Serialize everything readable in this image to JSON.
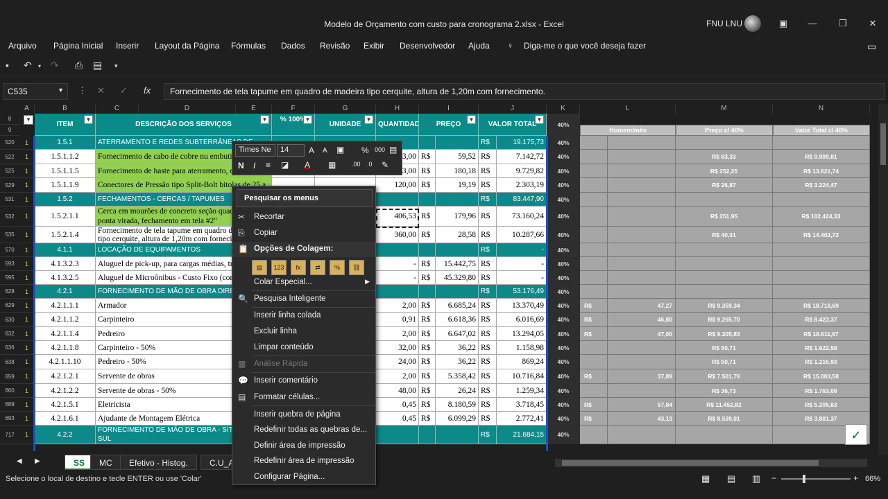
{
  "window": {
    "title": "Modelo de Orçamento com custo para cronograma 2.xlsx  -  Excel",
    "user": "FNU LNU"
  },
  "menu": [
    "Arquivo",
    "Página Inicial",
    "Inserir",
    "Layout da Página",
    "Fórmulas",
    "Dados",
    "Revisão",
    "Exibir",
    "Desenvolvedor",
    "Ajuda"
  ],
  "tell_me": "Diga-me o que você deseja fazer",
  "namebox": "C535",
  "formula": "Fornecimento de tela tapume em quadro de madeira tipo cerquite, altura de 1,20m com fornecimento.",
  "columns": [
    "A",
    "B",
    "C",
    "D",
    "E",
    "F",
    "G",
    "H",
    "I",
    "J",
    "K",
    "L",
    "M",
    "N"
  ],
  "headers": {
    "item": "ITEM",
    "desc": "DESCRIÇÃO DOS SERVIÇOS",
    "pct": "% 100%",
    "unidade": "UNIDADE",
    "quantidade": "QUANTIDADE",
    "preco": "PREÇO",
    "valor_total": "VALOR TOTAL",
    "k": "40%",
    "l": "Homem/mês",
    "m": "Preço c/ 40%",
    "n": "Valor Total c/ 40%"
  },
  "rows": [
    {
      "rn": "520",
      "a": "1",
      "item": "1.5.1",
      "desc": "ATERRAMENTO E REDES SUBTERRÂNEAS DE",
      "qty": "",
      "rs1": "",
      "preco": "",
      "rs2": "R$",
      "total": "19.175,73",
      "type": "teal",
      "l1": "",
      "l2": "",
      "m": "",
      "n": ""
    },
    {
      "rn": "522",
      "a": "1",
      "item": "1.5.1.1.2",
      "desc": "Fornecimento de cabo de cobre nu embutido escavação em terra até 50 cm de profundidade",
      "qty": "3,00",
      "rs1": "R$",
      "preco": "59,52",
      "rs2": "R$",
      "total": "7.142,72",
      "type": "green",
      "l1": "",
      "l2": "",
      "m": "R$ 83,33",
      "n": "R$ 9.999,81"
    },
    {
      "rn": "525",
      "a": "1",
      "item": "1.5.1.1.5",
      "desc": "Fornecimento de haste para aterramento, em",
      "qty": "3,00",
      "rs1": "R$",
      "preco": "180,18",
      "rs2": "R$",
      "total": "9.729,82",
      "type": "green",
      "l1": "",
      "l2": "",
      "m": "R$ 252,25",
      "n": "R$ 13.621,74"
    },
    {
      "rn": "529",
      "a": "1",
      "item": "1.5.1.1.9",
      "desc": "Conectores de Pressão tipo Split-Bolt bitolas de 25 a 70mm2",
      "qty": "120,00",
      "rs1": "R$",
      "preco": "19,19",
      "rs2": "R$",
      "total": "2.303,19",
      "type": "green",
      "l1": "",
      "l2": "",
      "m": "R$ 26,87",
      "n": "R$ 3.224,47"
    },
    {
      "rn": "531",
      "a": "1",
      "item": "1.5.2",
      "desc": "FECHAMENTOS - CERCAS / TAPUMES",
      "qty": "",
      "rs1": "",
      "preco": "",
      "rs2": "R$",
      "total": "83.447,90",
      "type": "teal",
      "l1": "",
      "l2": "",
      "m": "",
      "n": ""
    },
    {
      "rn": "532",
      "a": "1",
      "item": "1.5.2.1.1",
      "desc": "Cerca em mourões de concreto seção quadrada 2,5m, ponta virada, fechamento em tela #2\"",
      "qty": "406,53",
      "rs1": "R$",
      "preco": "179,96",
      "rs2": "R$",
      "total": "73.160,24",
      "type": "green",
      "l1": "",
      "l2": "",
      "m": "R$ 251,95",
      "n": "R$ 102.424,33"
    },
    {
      "rn": "535",
      "a": "1",
      "item": "1.5.2.1.4",
      "desc": "Fornecimento de tela tapume em quadro de madeira tipo cerquite, altura de 1,20m com fornecimento",
      "qty": "360,00",
      "rs1": "R$",
      "preco": "28,58",
      "rs2": "R$",
      "total": "10.287,66",
      "type": "white",
      "l1": "",
      "l2": "",
      "m": "R$ 40,01",
      "n": "R$ 14.402,72"
    },
    {
      "rn": "570",
      "a": "1",
      "item": "4.1.1",
      "desc": "LOCAÇÃO DE EQUIPAMENTOS",
      "qty": "",
      "rs1": "",
      "preco": "",
      "rs2": "R$",
      "total": "-",
      "type": "teal",
      "l1": "",
      "l2": "",
      "m": "",
      "n": ""
    },
    {
      "rn": "593",
      "a": "1",
      "item": "4.1.3.2.3",
      "desc": "Aluguel de pick-up, para cargas médias, tração 4x4 - 5 lugares (Tipo Hilux, Amarok, etc.)",
      "qty": "-",
      "rs1": "R$",
      "preco": "15.442,75",
      "rs2": "R$",
      "total": "-",
      "type": "white",
      "l1": "",
      "l2": "",
      "m": "",
      "n": ""
    },
    {
      "rn": "595",
      "a": "1",
      "item": "4.1.3.2.5",
      "desc": "Aluguel de Microônibus - Custo Fixo (com motorista) inclusive combustível",
      "qty": "-",
      "rs1": "R$",
      "preco": "45.329,80",
      "rs2": "R$",
      "total": "-",
      "type": "white",
      "l1": "",
      "l2": "",
      "m": "",
      "n": ""
    },
    {
      "rn": "628",
      "a": "1",
      "item": "4.2.1",
      "desc": "FORNECIMENTO DE MÃO DE OBRA DIRETA -",
      "qty": "",
      "rs1": "",
      "preco": "",
      "rs2": "R$",
      "total": "53.176,49",
      "type": "teal",
      "l1": "",
      "l2": "",
      "m": "",
      "n": ""
    },
    {
      "rn": "629",
      "a": "1",
      "item": "4.2.1.1.1",
      "desc": "Armador",
      "qty": "2,00",
      "rs1": "R$",
      "preco": "6.685,24",
      "rs2": "R$",
      "total": "13.370,49",
      "type": "white",
      "l1": "R$",
      "l2": "47,27",
      "m": "R$ 9.359,34",
      "n": "R$ 18.718,69"
    },
    {
      "rn": "630",
      "a": "1",
      "item": "4.2.1.1.2",
      "desc": "Carpinteiro",
      "qty": "0,91",
      "rs1": "R$",
      "preco": "6.618,36",
      "rs2": "R$",
      "total": "6.016,69",
      "type": "white",
      "l1": "R$",
      "l2": "46,80",
      "m": "R$ 9.265,70",
      "n": "R$ 8.423,37"
    },
    {
      "rn": "632",
      "a": "1",
      "item": "4.2.1.1.4",
      "desc": "Pedreiro",
      "qty": "2,00",
      "rs1": "R$",
      "preco": "6.647,02",
      "rs2": "R$",
      "total": "13.294,05",
      "type": "white",
      "l1": "R$",
      "l2": "47,00",
      "m": "R$ 9.305,83",
      "n": "R$ 18.611,67"
    },
    {
      "rn": "636",
      "a": "1",
      "item": "4.2.1.1.8",
      "desc": "Carpinteiro - 50%",
      "qty": "32,00",
      "rs1": "R$",
      "preco": "36,22",
      "rs2": "R$",
      "total": "1.158,98",
      "type": "white",
      "l1": "",
      "l2": "",
      "m": "R$ 50,71",
      "n": "R$ 1.622,58"
    },
    {
      "rn": "638",
      "a": "1",
      "item": "4.2.1.1.10",
      "desc": "Pedreiro - 50%",
      "qty": "24,00",
      "rs1": "R$",
      "preco": "36,22",
      "rs2": "R$",
      "total": "869,24",
      "type": "white",
      "l1": "",
      "l2": "",
      "m": "R$ 50,71",
      "n": "R$ 1.216,93"
    },
    {
      "rn": "659",
      "a": "1",
      "item": "4.2.1.2.1",
      "desc": "Servente de obras",
      "qty": "2,00",
      "rs1": "R$",
      "preco": "5.358,42",
      "rs2": "R$",
      "total": "10.716,84",
      "type": "white",
      "l1": "R$",
      "l2": "37,89",
      "m": "R$ 7.501,79",
      "n": "R$ 15.003,58"
    },
    {
      "rn": "660",
      "a": "1",
      "item": "4.2.1.2.2",
      "desc": "Servente de obras - 50%",
      "qty": "48,00",
      "rs1": "R$",
      "preco": "26,24",
      "rs2": "R$",
      "total": "1.259,34",
      "type": "white",
      "l1": "",
      "l2": "",
      "m": "R$ 36,73",
      "n": "R$ 1.763,08"
    },
    {
      "rn": "689",
      "a": "1",
      "item": "4.2.1.5.1",
      "desc": "Eletricista",
      "qty": "0,45",
      "rs1": "R$",
      "preco": "8.180,59",
      "rs2": "R$",
      "total": "3.718,45",
      "type": "white",
      "l1": "R$",
      "l2": "57,84",
      "m": "R$ 11.452,82",
      "n": "R$ 5.205,83"
    },
    {
      "rn": "693",
      "a": "1",
      "item": "4.2.1.6.1",
      "desc": "Ajudante de Montagem Elétrica",
      "qty": "0,45",
      "rs1": "R$",
      "preco": "6.099,29",
      "rs2": "R$",
      "total": "2.772,41",
      "type": "white",
      "l1": "R$",
      "l2": "43,13",
      "m": "R$ 8.539,01",
      "n": "R$ 3.881,37"
    },
    {
      "rn": "717",
      "a": "1",
      "item": "4.2.2",
      "desc": "FORNECIMENTO DE MÃO DE OBRA - SITE SERRA SUL",
      "qty": "",
      "rs1": "",
      "preco": "",
      "rs2": "R$",
      "total": "21.684,15",
      "type": "teal",
      "l1": "",
      "l2": "",
      "m": "",
      "n": ""
    }
  ],
  "k_value": "40%",
  "mini_toolbar": {
    "font": "Times Ne",
    "size": "14"
  },
  "context_menu": {
    "search": "Pesquisar os menus",
    "items": [
      {
        "label": "Recortar",
        "icon": "✂"
      },
      {
        "label": "Copiar",
        "icon": "⎘"
      },
      {
        "label": "Opções de Colagem:",
        "icon": "📋"
      },
      {
        "label": "Colar Especial...",
        "icon": ""
      },
      {
        "label": "Pesquisa Inteligente",
        "icon": "🔍"
      },
      {
        "label": "Inserir linha colada",
        "icon": ""
      },
      {
        "label": "Excluir linha",
        "icon": ""
      },
      {
        "label": "Limpar conteúdo",
        "icon": ""
      },
      {
        "label": "Análise Rápida",
        "icon": "▦"
      },
      {
        "label": "Inserir comentário",
        "icon": "💬"
      },
      {
        "label": "Formatar células...",
        "icon": "▤"
      },
      {
        "label": "Inserir quebra de página",
        "icon": ""
      },
      {
        "label": "Redefinir todas as quebras de...",
        "icon": ""
      },
      {
        "label": "Definir área de impressão",
        "icon": ""
      },
      {
        "label": "Redefinir área de impressão",
        "icon": ""
      },
      {
        "label": "Configurar Página...",
        "icon": ""
      }
    ]
  },
  "sheets": [
    "SS",
    "MC",
    "Efetivo - Histog.",
    "C.U_Ac"
  ],
  "status": {
    "message": "Selecione o local de destino e tecle ENTER ou use 'Colar'",
    "zoom": "66%"
  }
}
